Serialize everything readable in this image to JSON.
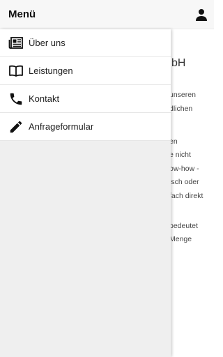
{
  "header": {
    "title": "Menü",
    "user_icon": "person-icon"
  },
  "menu": {
    "items": [
      {
        "label": "Über uns",
        "icon": "newspaper-icon"
      },
      {
        "label": "Leistungen",
        "icon": "book-icon"
      },
      {
        "label": "Kontakt",
        "icon": "phone-icon"
      },
      {
        "label": "Anfrageformular",
        "icon": "pencil-icon"
      }
    ]
  },
  "background": {
    "heading_fragment": "bH",
    "lines": [
      "unseren",
      "dlichen",
      "",
      "en",
      "e nicht",
      "ow-how -",
      "isch oder",
      "fach direkt",
      "",
      "bedeutet",
      "Menge"
    ]
  }
}
